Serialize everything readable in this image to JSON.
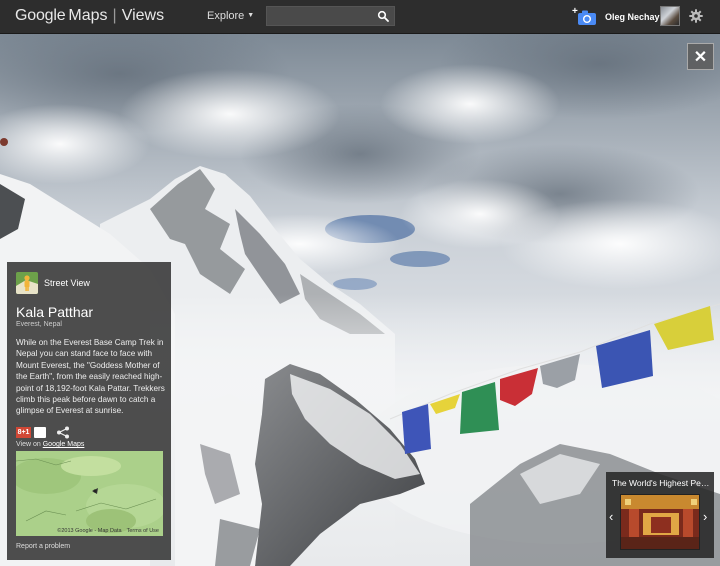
{
  "header": {
    "logo_brand": "Google",
    "logo_product": "Maps",
    "logo_section": "Views",
    "explore_label": "Explore",
    "search": {
      "value": "",
      "placeholder": ""
    },
    "username": "Oleg Nechay"
  },
  "panel": {
    "type_label": "Street View",
    "place_title": "Kala Patthar",
    "place_subtitle": "Everest, Nepal",
    "description": "While on the Everest Base Camp Trek in Nepal you can stand face to face with Mount Everest, the \"Goddess Mother of the Earth\", from the easily reached high-point of 18,192-foot Kala Pattar. Trekkers climb this peak before dawn to catch a glimpse of Everest at sunrise.",
    "gplus_label": "8+1",
    "view_on_prefix": "View on",
    "view_on_link": "Google Maps",
    "map_copyright": "©2013 Google - Map Data",
    "map_terms": "Terms of Use",
    "report_label": "Report a problem"
  },
  "carousel": {
    "title": "The World's Highest Pea...",
    "prev_glyph": "‹",
    "next_glyph": "›"
  },
  "close_glyph": "✕",
  "icons": {
    "search": "search-icon",
    "camera": "add-photo-camera-icon",
    "settings": "gear-icon",
    "share": "share-icon",
    "street_view": "street-view-pegman-icon",
    "close": "close-icon"
  },
  "colors": {
    "topbar": "#2d2d2d",
    "panel": "#282828",
    "camera_accent": "#4a8af4",
    "gplus": "#d14836",
    "map_green": "#aacf86"
  }
}
